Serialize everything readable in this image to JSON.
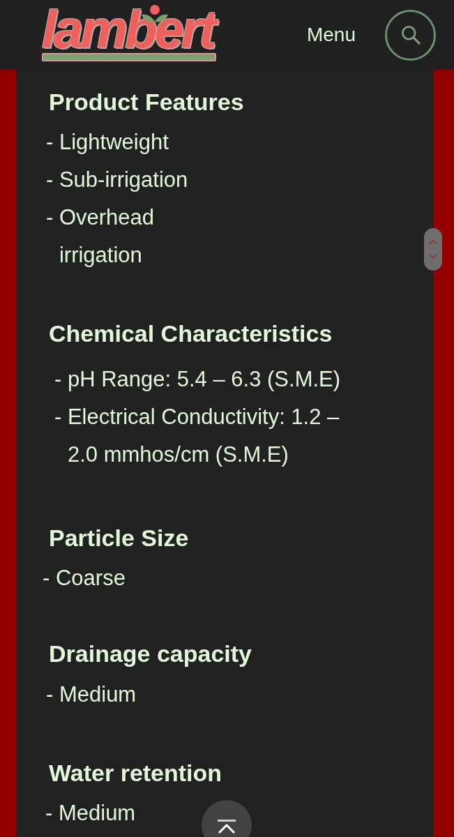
{
  "header": {
    "logo": {
      "text": "lambert"
    },
    "menu_label": "Menu"
  },
  "sections": [
    {
      "heading": "Product Features",
      "items": [
        "- Lightweight",
        "- Sub-irrigation",
        "- Overhead irrigation"
      ]
    },
    {
      "heading": "Chemical Characteristics",
      "items": [
        "- pH Range: 5.4 – 6.3 (S.M.E)",
        "- Electrical Conductivity: 1.2 – 2.0 mmhos/cm (S.M.E)"
      ]
    },
    {
      "heading": "Particle Size",
      "items": [
        "- Coarse"
      ]
    },
    {
      "heading": "Drainage capacity",
      "items": [
        "- Medium"
      ]
    },
    {
      "heading": "Water retention",
      "items": [
        "- Medium"
      ]
    }
  ]
}
